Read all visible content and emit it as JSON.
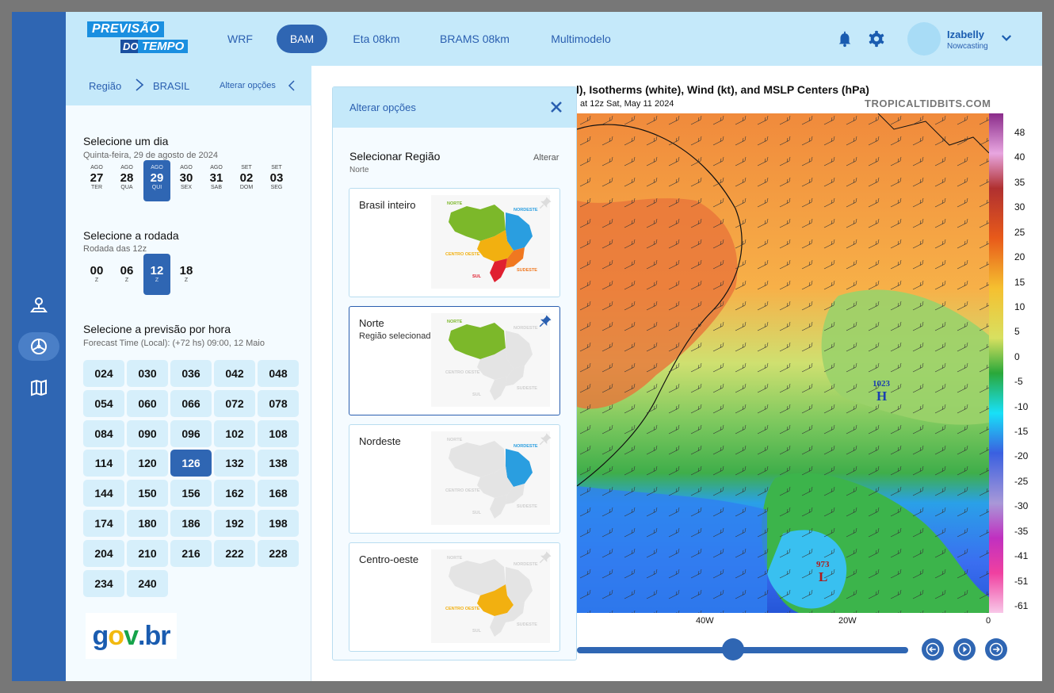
{
  "header": {
    "logo_line1": "PREVISÃO",
    "logo_do": "DO",
    "logo_tempo": "TEMPO",
    "models": [
      {
        "label": "WRF",
        "active": false
      },
      {
        "label": "BAM",
        "active": true
      },
      {
        "label": "Eta 08km",
        "active": false
      },
      {
        "label": "BRAMS 08km",
        "active": false
      },
      {
        "label": "Multimodelo",
        "active": false
      }
    ],
    "user": {
      "name": "Izabelly",
      "role": "Nowcasting"
    }
  },
  "breadcrumb": {
    "root": "Região",
    "current": "BRASIL",
    "action": "Alterar opções"
  },
  "day_section": {
    "title": "Selecione um dia",
    "subtitle": "Quinta-feira, 29 de agosto de 2024",
    "days": [
      {
        "month": "AGO",
        "day": "27",
        "weekday": "TER",
        "selected": false
      },
      {
        "month": "AGO",
        "day": "28",
        "weekday": "QUA",
        "selected": false
      },
      {
        "month": "AGO",
        "day": "29",
        "weekday": "QUI",
        "selected": true
      },
      {
        "month": "AGO",
        "day": "30",
        "weekday": "SEX",
        "selected": false
      },
      {
        "month": "AGO",
        "day": "31",
        "weekday": "SAB",
        "selected": false
      },
      {
        "month": "SET",
        "day": "02",
        "weekday": "DOM",
        "selected": false
      },
      {
        "month": "SET",
        "day": "03",
        "weekday": "SEG",
        "selected": false
      }
    ]
  },
  "run_section": {
    "title": "Selecione a rodada",
    "subtitle": "Rodada das 12z",
    "runs": [
      {
        "hour": "00",
        "unit": "Z",
        "selected": false
      },
      {
        "hour": "06",
        "unit": "Z",
        "selected": false
      },
      {
        "hour": "12",
        "unit": "Z",
        "selected": true
      },
      {
        "hour": "18",
        "unit": "Z",
        "selected": false
      }
    ]
  },
  "forecast_section": {
    "title": "Selecione a previsão por hora",
    "subtitle": "Forecast Time (Local): (+72 hs) 09:00, 12 Maio",
    "hours": [
      "024",
      "030",
      "036",
      "042",
      "048",
      "054",
      "060",
      "066",
      "072",
      "078",
      "084",
      "090",
      "096",
      "102",
      "108",
      "114",
      "120",
      "126",
      "132",
      "138",
      "144",
      "150",
      "156",
      "162",
      "168",
      "174",
      "180",
      "186",
      "192",
      "198",
      "204",
      "210",
      "216",
      "222",
      "228",
      "234",
      "240"
    ],
    "selected": "126"
  },
  "govbr": {
    "text_g": "g",
    "text_o": "o",
    "text_v": "v",
    "text_dot": ".",
    "text_b": "b",
    "text_r": "r"
  },
  "map": {
    "title": "l), Isotherms (white), Wind (kt), and MSLP Centers (hPa)",
    "subtitle": "at 12z Sat, May 11 2024",
    "watermark": "TROPICALTIDBITS.COM",
    "colorbar_labels": [
      "48",
      "40",
      "35",
      "30",
      "25",
      "20",
      "15",
      "10",
      "5",
      "0",
      "-5",
      "-10",
      "-15",
      "-20",
      "-25",
      "-30",
      "-35",
      "-41",
      "-51",
      "-61"
    ],
    "x_labels": [
      "40W",
      "20W",
      "0"
    ],
    "high_center": {
      "value": "1023",
      "letter": "H"
    },
    "low_center": {
      "value": "973",
      "letter": "L"
    }
  },
  "panel": {
    "header": "Alterar opções",
    "section_title": "Selecionar Região",
    "section_value": "Norte",
    "section_action": "Alterar",
    "cards": [
      {
        "name": "Brasil inteiro",
        "sub": "",
        "selected": false,
        "highlight": "all"
      },
      {
        "name": "Norte",
        "sub": "Região selecionada",
        "selected": true,
        "highlight": "norte"
      },
      {
        "name": "Nordeste",
        "sub": "",
        "selected": false,
        "highlight": "nordeste"
      },
      {
        "name": "Centro-oeste",
        "sub": "",
        "selected": false,
        "highlight": "centro"
      }
    ],
    "mini_labels": {
      "norte": "NORTE",
      "nordeste": "NORDESTE",
      "centro": "CENTRO OESTE",
      "sudeste": "SUDESTE",
      "sul": "SUL"
    }
  },
  "colors": {
    "primary": "#2f66b3",
    "header_bg": "#c5e9fa",
    "accent": "#1a8fe0"
  }
}
